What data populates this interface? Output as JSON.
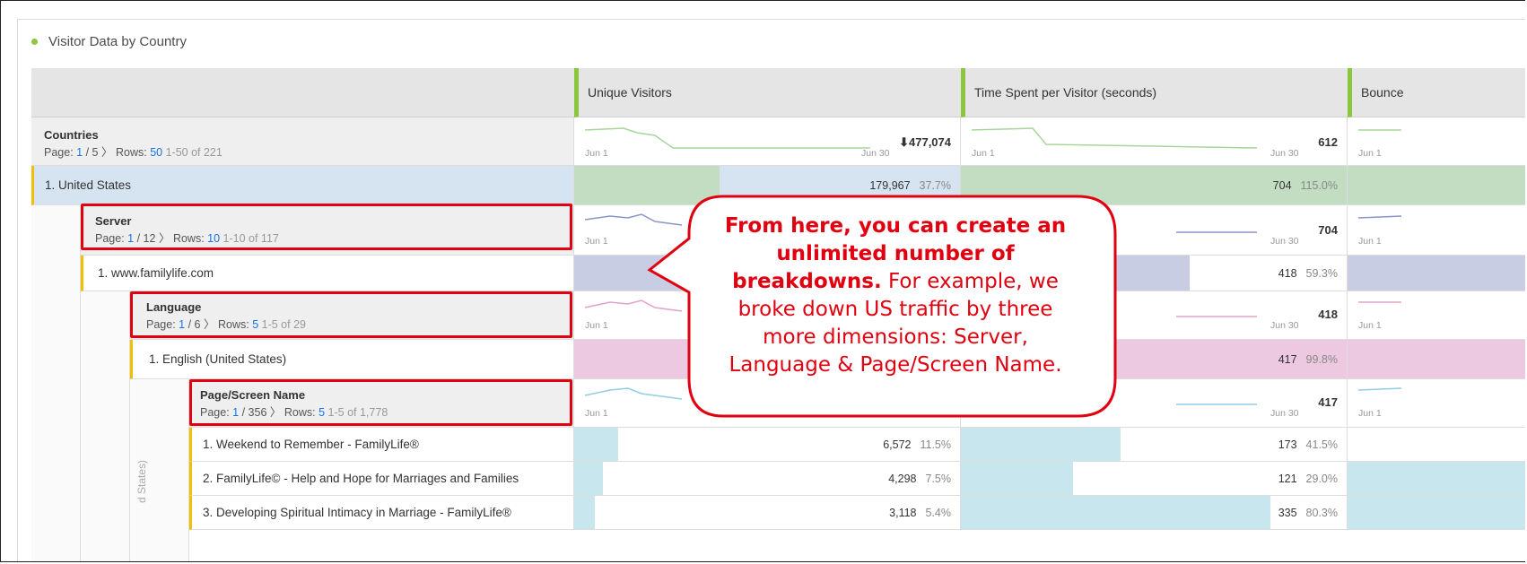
{
  "panel": {
    "title": "Visitor Data by Country"
  },
  "columns": {
    "unique_visitors": "Unique Visitors",
    "time_spent": "Time Spent per Visitor (seconds)",
    "bounce": "Bounce"
  },
  "sparkline": {
    "start": "Jun 1",
    "end": "Jun 30"
  },
  "countries": {
    "title": "Countries",
    "page_label": "Page:",
    "page_current": "1",
    "page_total": "/ 5",
    "rows_label": "Rows:",
    "rows_value": "50",
    "range": "1-50 of 221",
    "total_visitors": "477,074",
    "total_time": "612"
  },
  "us_row": {
    "label": "1.  United States",
    "visitors": "179,967",
    "visitors_pct": "37.7%",
    "visitors_fill": 0.377,
    "time": "704",
    "time_pct": "115.0%"
  },
  "server": {
    "title": "Server",
    "page_current": "1",
    "page_total": "/ 12",
    "rows_value": "10",
    "range": "1-10 of 117",
    "total_time": "704"
  },
  "server_row": {
    "label": "1.  www.familylife.com",
    "time": "418",
    "time_pct": "59.3%",
    "time_fill": 0.593
  },
  "language": {
    "title": "Language",
    "page_current": "1",
    "page_total": "/ 6",
    "rows_value": "5",
    "range": "1-5 of 29",
    "total_time": "418"
  },
  "language_row": {
    "label": "1.  English (United States)",
    "time": "417",
    "time_pct": "99.8%",
    "time_fill": 0.998
  },
  "page_screen": {
    "title": "Page/Screen Name",
    "page_current": "1",
    "page_total": "/ 356",
    "rows_value": "5",
    "range": "1-5 of 1,778",
    "total_time": "417"
  },
  "pages": [
    {
      "label": "1.  Weekend to Remember - FamilyLife®",
      "visitors": "6,572",
      "visitors_pct": "11.5%",
      "vfill": 0.115,
      "time": "173",
      "time_pct": "41.5%",
      "tfill": 0.415
    },
    {
      "label": "2.  FamilyLife© - Help and Hope for Marriages and Families",
      "visitors": "4,298",
      "visitors_pct": "7.5%",
      "vfill": 0.075,
      "time": "121",
      "time_pct": "29.0%",
      "tfill": 0.29
    },
    {
      "label": "3.  Developing Spiritual Intimacy in Marriage - FamilyLife®",
      "visitors": "3,118",
      "visitors_pct": "5.4%",
      "vfill": 0.054,
      "time": "335",
      "time_pct": "80.3%",
      "tfill": 0.803
    }
  ],
  "vertical_label": "d States)",
  "callout": {
    "bold": "From here, you can create an unlimited number of breakdowns.",
    "rest": " For example, we broke down US traffic by three more dimensions: Server, Language & Page/Screen Name."
  },
  "colors": {
    "accent_green": "#8cc63f",
    "callout_red": "#e1000f",
    "link_blue": "#1473e6"
  }
}
